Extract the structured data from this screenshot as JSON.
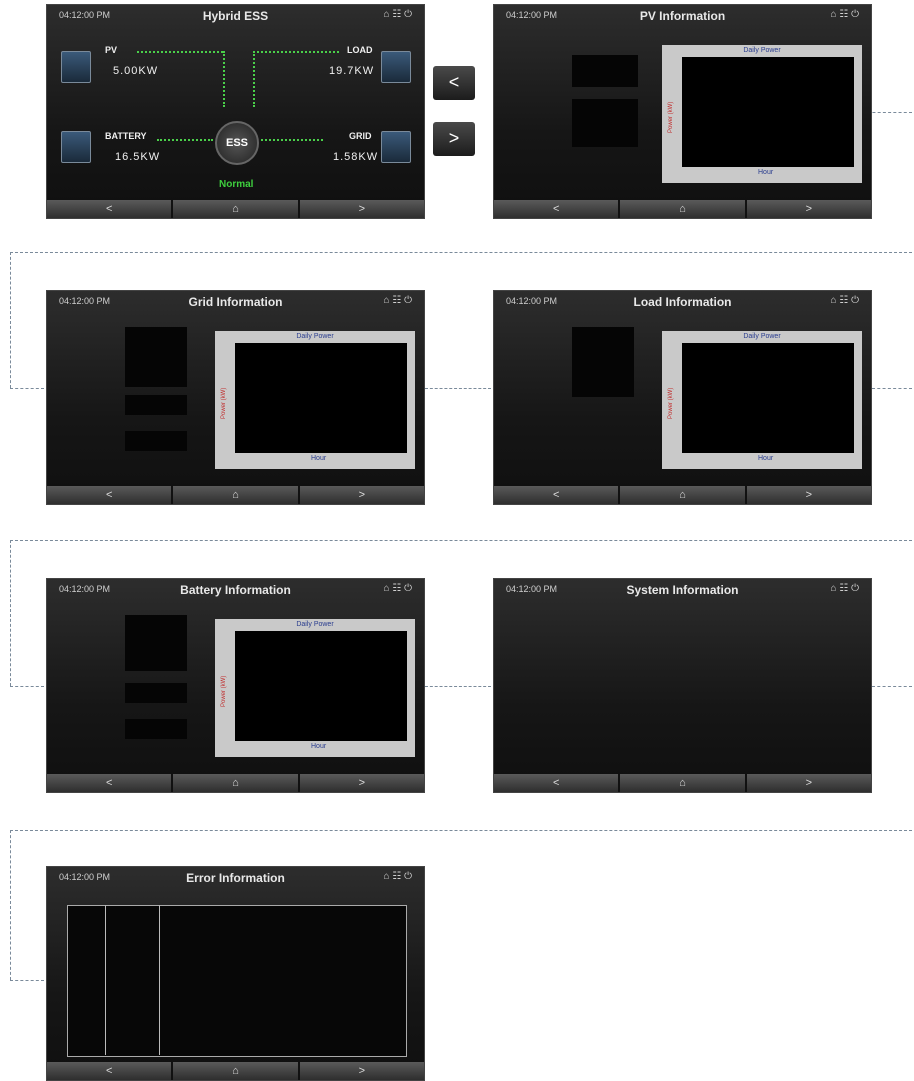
{
  "screens": {
    "home": {
      "time": "04:12:00 PM",
      "title": "Hybrid ESS",
      "status_icons": "⌂ ☷ ⏻",
      "pv_label": "PV",
      "pv_value": "5.00KW",
      "load_label": "LOAD",
      "load_value": "19.7KW",
      "battery_label": "BATTERY",
      "battery_value": "16.5KW",
      "grid_label": "GRID",
      "grid_value": "1.58KW",
      "ess_label": "ESS",
      "status": "Normal"
    },
    "pv": {
      "time": "04:12:00 PM",
      "title": "PV Information",
      "status_icons": "⌂ ☷ ⏻",
      "chart_title": "Daily Power",
      "y_label": "Power (kW)",
      "x_label": "Hour"
    },
    "grid": {
      "time": "04:12:00 PM",
      "title": "Grid Information",
      "status_icons": "⌂ ☷ ⏻",
      "chart_title": "Daily Power",
      "y_label": "Power (kW)",
      "x_label": "Hour"
    },
    "load": {
      "time": "04:12:00 PM",
      "title": "Load Information",
      "status_icons": "⌂ ☷ ⏻",
      "chart_title": "Daily Power",
      "y_label": "Power (kW)",
      "x_label": "Hour"
    },
    "battery": {
      "time": "04:12:00 PM",
      "title": "Battery Information",
      "status_icons": "⌂ ☷ ⏻",
      "chart_title": "Daily Power",
      "y_label": "Power (kW)",
      "x_label": "Hour"
    },
    "system": {
      "time": "04:12:00 PM",
      "title": "System Information",
      "status_icons": "⌂ ☷ ⏻"
    },
    "error": {
      "time": "04:12:00 PM",
      "title": "Error Information",
      "status_icons": "⌂ ☷ ⏻"
    }
  },
  "nav": {
    "prev": "<",
    "home": "⌂",
    "next": ">"
  },
  "side_buttons": {
    "prev": "<",
    "next": ">"
  },
  "colors": {
    "flow_line": "#4ad04a",
    "status_green": "#3ecf3e",
    "chart_line": "#e04040",
    "system_value": "#5fb8e0"
  }
}
